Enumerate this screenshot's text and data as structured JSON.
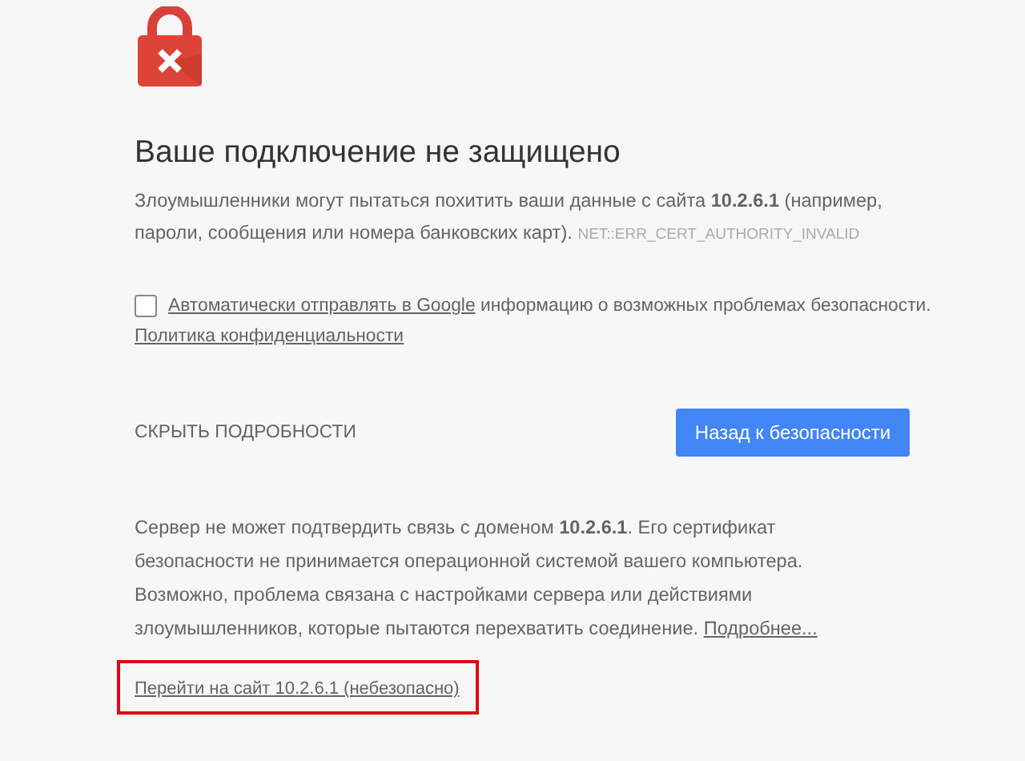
{
  "title": "Ваше подключение не защищено",
  "warning": {
    "text": "Злоумышленники могут пытаться похитить ваши данные с сайта **10.2.6.1** (например, пароли, сообщения или номера банковских карт).",
    "error_code": "NET::ERR_CERT_AUTHORITY_INVALID"
  },
  "report": {
    "checked": false,
    "link": "Автоматически отправлять в Google",
    "text": "информацию о возможных проблемах безопасности.",
    "privacy_link": "Политика конфиденциальности"
  },
  "details_toggle": "СКРЫТЬ ПОДРОБНОСТИ",
  "back_button": "Назад к безопасности",
  "details": {
    "text": "Сервер не может подтвердить связь с доменом **10.2.6.1**. Его сертификат безопасности не принимается операционной системой вашего компьютера. Возможно, проблема связана с настройками сервера или действиями злоумышленников, которые пытаются перехватить соединение.",
    "link": "Подробнее..."
  },
  "proceed_link": {
    "text": "Перейти на сайт 10.2.6.1 (небезопасно)",
    "highlighted": true
  }
}
